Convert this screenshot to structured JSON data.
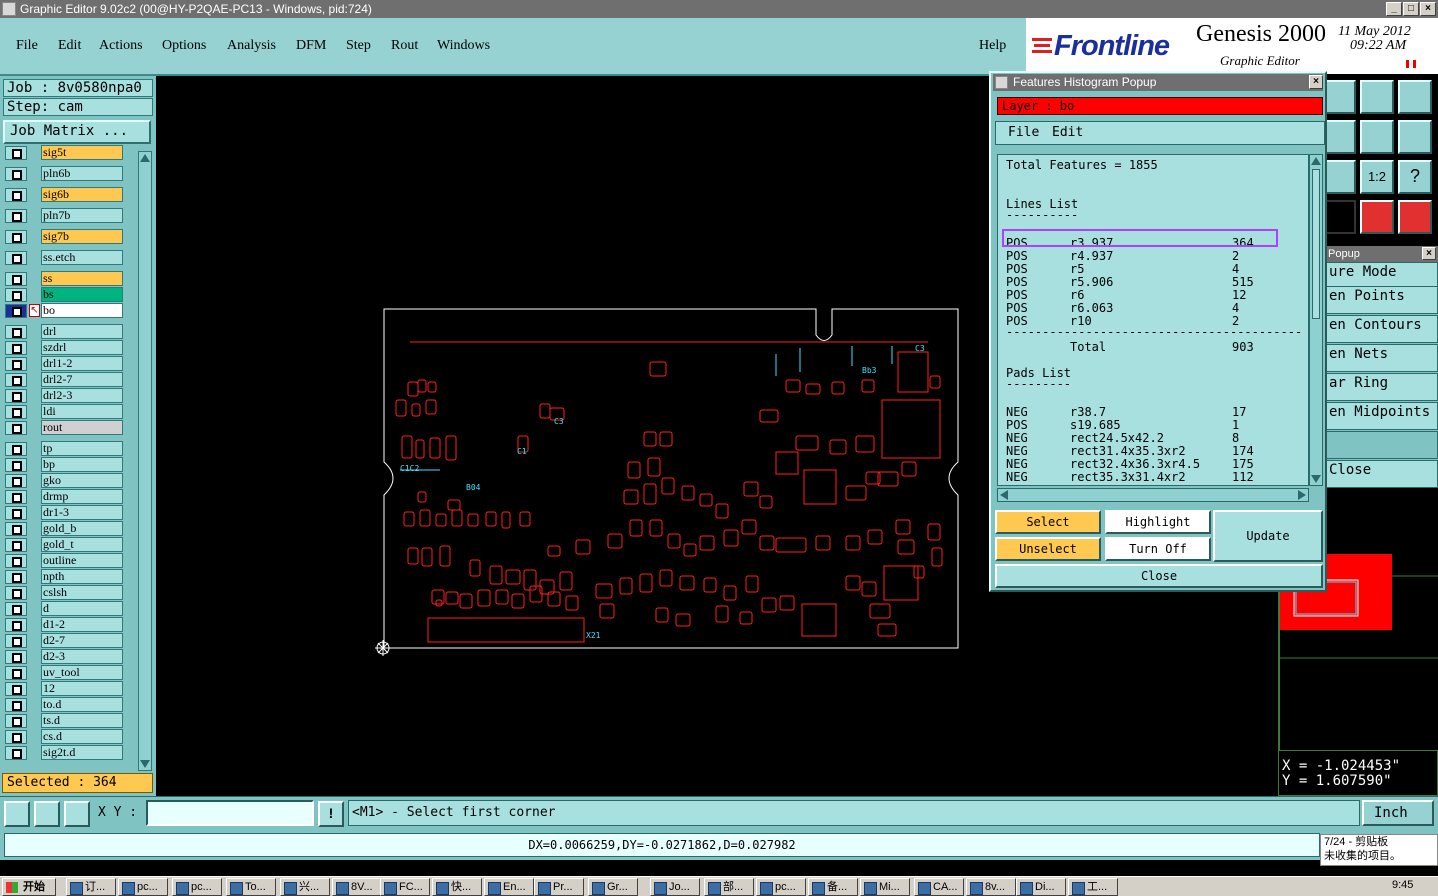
{
  "window": {
    "title": "Graphic Editor 9.02c2 (00@HY-P2QAE-PC13 - Windows, pid:724)"
  },
  "menu": {
    "items": [
      "File",
      "Edit",
      "Actions",
      "Options",
      "Analysis",
      "DFM",
      "Step",
      "Rout",
      "Windows"
    ],
    "help": "Help"
  },
  "brand": {
    "logo": "Frontline",
    "product": "Genesis 2000",
    "subtitle": "Graphic Editor",
    "date": "11 May 2012",
    "time": "09:22 AM"
  },
  "job": {
    "job_label": "Job : 8v0580npa0",
    "step_label": "Step: cam",
    "matrix_button": "Job Matrix ..."
  },
  "layers": [
    {
      "name": "sig5t",
      "color": "#ffc850"
    },
    {
      "name": "pln6b",
      "color": "#a8e0e0"
    },
    {
      "name": "sig6b",
      "color": "#ffc850"
    },
    {
      "name": "pln7b",
      "color": "#a8e0e0"
    },
    {
      "name": "sig7b",
      "color": "#ffc850"
    },
    {
      "name": "ss.etch",
      "color": "#a8e0e0"
    },
    {
      "name": "ss",
      "color": "#ffc850"
    },
    {
      "name": "bs",
      "color": "#00b480"
    },
    {
      "name": "bo",
      "color": "#ffffff"
    },
    {
      "name": "drl",
      "color": "#a8e0e0"
    },
    {
      "name": "szdrl",
      "color": "#a8e0e0"
    },
    {
      "name": "drl1-2",
      "color": "#a8e0e0"
    },
    {
      "name": "drl2-7",
      "color": "#a8e0e0"
    },
    {
      "name": "drl2-3",
      "color": "#a8e0e0"
    },
    {
      "name": "ldi",
      "color": "#a8e0e0"
    },
    {
      "name": "rout",
      "color": "#d0d0d0"
    },
    {
      "name": "tp",
      "color": "#a8e0e0"
    },
    {
      "name": "bp",
      "color": "#a8e0e0"
    },
    {
      "name": "gko",
      "color": "#a8e0e0"
    },
    {
      "name": "drmp",
      "color": "#a8e0e0"
    },
    {
      "name": "dr1-3",
      "color": "#a8e0e0"
    },
    {
      "name": "gold_b",
      "color": "#a8e0e0"
    },
    {
      "name": "gold_t",
      "color": "#a8e0e0"
    },
    {
      "name": "outline",
      "color": "#a8e0e0"
    },
    {
      "name": "npth",
      "color": "#a8e0e0"
    },
    {
      "name": "cslsh",
      "color": "#a8e0e0"
    },
    {
      "name": "d",
      "color": "#a8e0e0"
    },
    {
      "name": "d1-2",
      "color": "#a8e0e0"
    },
    {
      "name": "d2-7",
      "color": "#a8e0e0"
    },
    {
      "name": "d2-3",
      "color": "#a8e0e0"
    },
    {
      "name": "uv_tool",
      "color": "#a8e0e0"
    },
    {
      "name": "12",
      "color": "#a8e0e0"
    },
    {
      "name": "to.d",
      "color": "#a8e0e0"
    },
    {
      "name": "ts.d",
      "color": "#a8e0e0"
    },
    {
      "name": "cs.d",
      "color": "#a8e0e0"
    },
    {
      "name": "sig2t.d",
      "color": "#a8e0e0"
    }
  ],
  "selected_label": "Selected : 364",
  "popup": {
    "title": "Features Histogram Popup",
    "layer_label": "Layer :  bo",
    "menu": [
      "File",
      "Edit"
    ],
    "total": "Total Features = 1855",
    "lines_title": "Lines List",
    "lines": [
      {
        "pol": "POS",
        "sym": "r3.937",
        "cnt": "364"
      },
      {
        "pol": "POS",
        "sym": "r4.937",
        "cnt": "2"
      },
      {
        "pol": "POS",
        "sym": "r5",
        "cnt": "4"
      },
      {
        "pol": "POS",
        "sym": "r5.906",
        "cnt": "515"
      },
      {
        "pol": "POS",
        "sym": "r6",
        "cnt": "12"
      },
      {
        "pol": "POS",
        "sym": "r6.063",
        "cnt": "4"
      },
      {
        "pol": "POS",
        "sym": "r10",
        "cnt": "2"
      }
    ],
    "lines_total_label": "Total",
    "lines_total": "903",
    "pads_title": "Pads List",
    "pads": [
      {
        "pol": "NEG",
        "sym": "r38.7",
        "cnt": "17"
      },
      {
        "pol": "POS",
        "sym": "s19.685",
        "cnt": "1"
      },
      {
        "pol": "NEG",
        "sym": "rect24.5x42.2",
        "cnt": "8"
      },
      {
        "pol": "NEG",
        "sym": "rect31.4x35.3xr2",
        "cnt": "174"
      },
      {
        "pol": "NEG",
        "sym": "rect32.4x36.3xr4.5",
        "cnt": "175"
      },
      {
        "pol": "NEG",
        "sym": "rect35.3x31.4xr2",
        "cnt": "112"
      }
    ],
    "buttons": {
      "select": "Select",
      "highlight": "Highlight",
      "update": "Update",
      "unselect": "Unselect",
      "turnoff": "Turn Off",
      "close": "Close"
    }
  },
  "rpopup": {
    "title": "Popup",
    "items": [
      "ure Mode",
      "en Points",
      "en Contours",
      "en Nets",
      "ar Ring",
      "en Midpoints",
      "",
      "Close"
    ]
  },
  "coords": {
    "x": "X  =  -1.024453\"",
    "y": "Y  =  1.607590\""
  },
  "board_labels": [
    "C3",
    "C3",
    "C1",
    "C1C2",
    "Bb3",
    "B04",
    "X21"
  ],
  "bottom": {
    "xy_label": "X Y :",
    "message": "<M1> - Select first corner",
    "unit": "Inch"
  },
  "status": {
    "dx": "DX=0.0066259,DY=-0.0271862,D=0.027982"
  },
  "notif": {
    "line1": "7/24 - 剪贴板",
    "line2": "未收集的项目。"
  },
  "taskbar": {
    "start": "开始",
    "items": [
      "订...",
      "pc...",
      "pc...",
      "To...",
      "兴...",
      "8V...",
      "FC...",
      "快...",
      "En...",
      "Pr...",
      "Gr...",
      "Jo...",
      "部...",
      "pc...",
      "备...",
      "Mi...",
      "CA...",
      "8v...",
      "Di...",
      "工..."
    ],
    "clock": "9:45"
  },
  "colors": {
    "accent_red": "#ff0000",
    "panel": "#7fc3c3",
    "highlight_box": "#b040ff",
    "board_line": "#ff2020",
    "board_text": "#40e0ff"
  }
}
